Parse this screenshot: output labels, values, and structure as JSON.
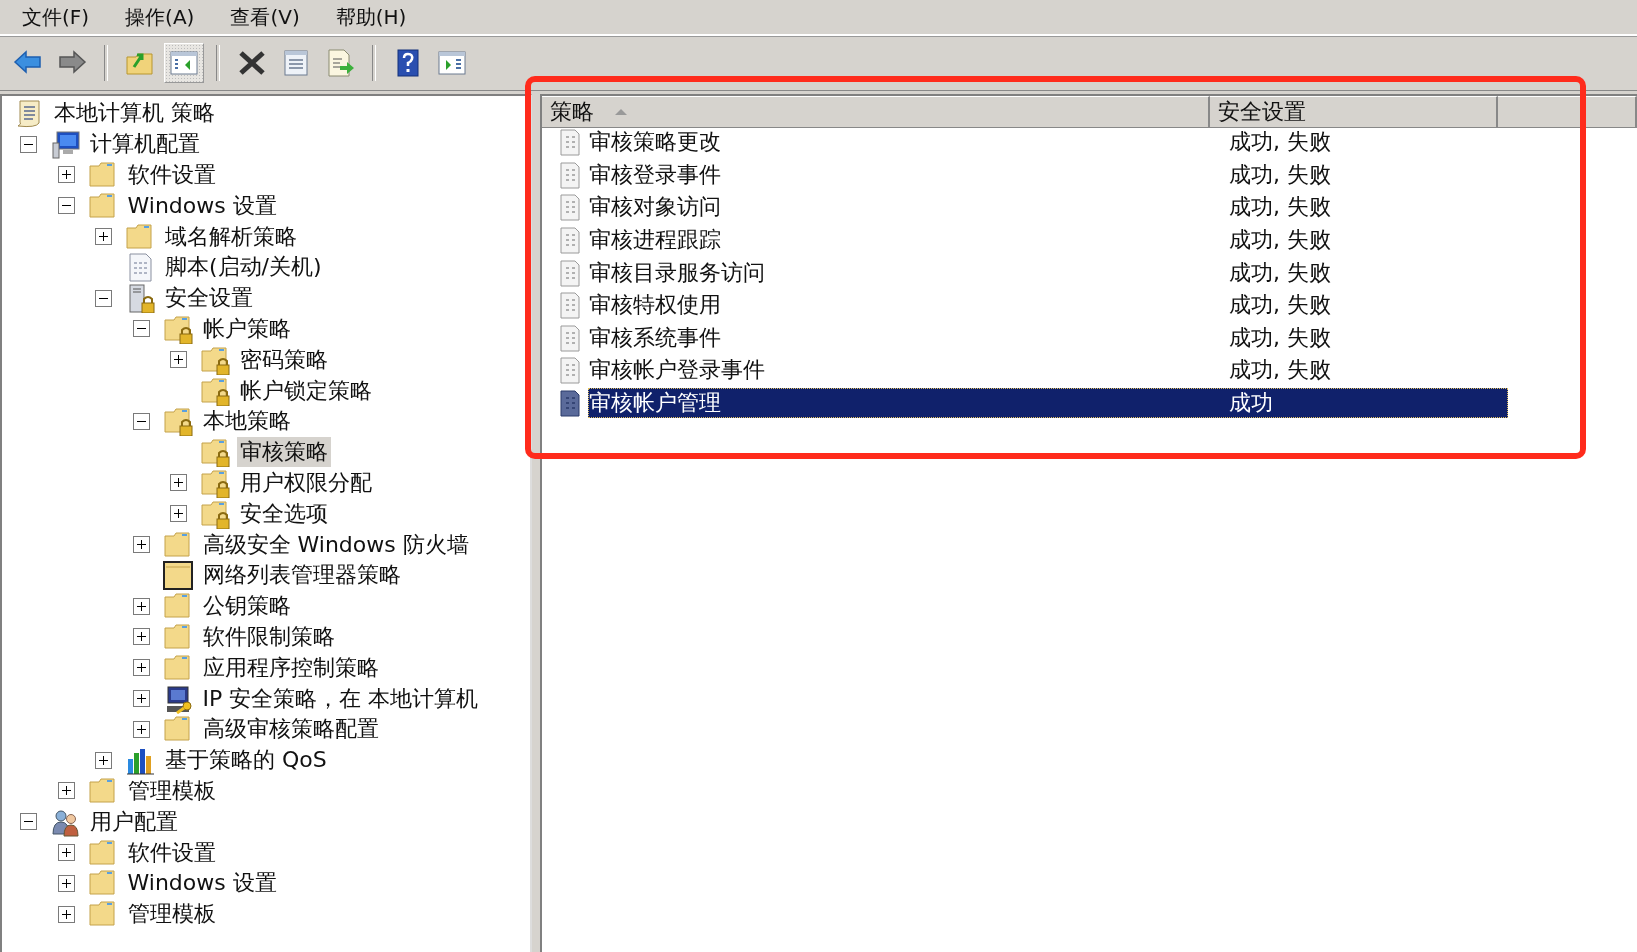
{
  "menu": [
    "文件(F)",
    "操作(A)",
    "查看(V)",
    "帮助(H)"
  ],
  "toolbar": [
    {
      "kind": "back"
    },
    {
      "kind": "forward"
    },
    {
      "kind": "sep"
    },
    {
      "kind": "up"
    },
    {
      "kind": "tree",
      "pressed": true
    },
    {
      "kind": "sep"
    },
    {
      "kind": "delete"
    },
    {
      "kind": "properties"
    },
    {
      "kind": "export"
    },
    {
      "kind": "sep"
    },
    {
      "kind": "help"
    },
    {
      "kind": "actionpane"
    }
  ],
  "tree": [
    {
      "label": "本地计算机 策略",
      "kind": "policy",
      "selected": false,
      "children": [
        {
          "label": "计算机配置",
          "kind": "computer",
          "expanded": true,
          "selected": false,
          "children": [
            {
              "label": "软件设置",
              "kind": "folder",
              "expanded": false,
              "selected": false
            },
            {
              "label": "Windows 设置",
              "kind": "folder",
              "expanded": true,
              "selected": false,
              "children": [
                {
                  "label": "域名解析策略",
                  "kind": "folder",
                  "expanded": false,
                  "selected": false
                },
                {
                  "label": "脚本(启动/关机)",
                  "kind": "script",
                  "selected": false
                },
                {
                  "label": "安全设置",
                  "kind": "security",
                  "expanded": true,
                  "selected": false,
                  "children": [
                    {
                      "label": "帐户策略",
                      "kind": "lockfolder",
                      "expanded": true,
                      "selected": false,
                      "children": [
                        {
                          "label": "密码策略",
                          "kind": "lockfolder",
                          "expanded": false,
                          "selected": false
                        },
                        {
                          "label": "帐户锁定策略",
                          "kind": "lockfolder",
                          "selected": false
                        }
                      ]
                    },
                    {
                      "label": "本地策略",
                      "kind": "lockfolder",
                      "expanded": true,
                      "selected": false,
                      "children": [
                        {
                          "label": "审核策略",
                          "kind": "lockfolder",
                          "selected": true
                        },
                        {
                          "label": "用户权限分配",
                          "kind": "lockfolder",
                          "expanded": false,
                          "selected": false
                        },
                        {
                          "label": "安全选项",
                          "kind": "lockfolder",
                          "expanded": false,
                          "selected": false
                        }
                      ]
                    },
                    {
                      "label": "高级安全 Windows 防火墙",
                      "kind": "folder",
                      "expanded": false,
                      "selected": false
                    },
                    {
                      "label": "网络列表管理器策略",
                      "kind": "framedfolder",
                      "selected": false
                    },
                    {
                      "label": "公钥策略",
                      "kind": "folder",
                      "expanded": false,
                      "selected": false
                    },
                    {
                      "label": "软件限制策略",
                      "kind": "folder",
                      "expanded": false,
                      "selected": false
                    },
                    {
                      "label": "应用程序控制策略",
                      "kind": "folder",
                      "expanded": false,
                      "selected": false
                    },
                    {
                      "label": "IP 安全策略，在 本地计算机",
                      "kind": "ipsec",
                      "expanded": false,
                      "selected": false
                    },
                    {
                      "label": "高级审核策略配置",
                      "kind": "folder",
                      "expanded": false,
                      "selected": false
                    }
                  ]
                },
                {
                  "label": "基于策略的 QoS",
                  "kind": "chart",
                  "expanded": false,
                  "selected": false
                }
              ]
            },
            {
              "label": "管理模板",
              "kind": "folder",
              "expanded": false,
              "selected": false
            }
          ]
        },
        {
          "label": "用户配置",
          "kind": "users",
          "expanded": true,
          "selected": false,
          "children": [
            {
              "label": "软件设置",
              "kind": "folder",
              "expanded": false,
              "selected": false
            },
            {
              "label": "Windows 设置",
              "kind": "folder",
              "expanded": false,
              "selected": false
            },
            {
              "label": "管理模板",
              "kind": "folder",
              "expanded": false,
              "selected": false
            }
          ]
        }
      ]
    }
  ],
  "table": {
    "columns": [
      {
        "label": "策略",
        "sorted_ascending": true
      },
      {
        "label": "安全设置"
      },
      {}
    ],
    "rows": [
      {
        "policy": "审核策略更改",
        "setting": "成功, 失败",
        "selected": false
      },
      {
        "policy": "审核登录事件",
        "setting": "成功, 失败",
        "selected": false
      },
      {
        "policy": "审核对象访问",
        "setting": "成功, 失败",
        "selected": false
      },
      {
        "policy": "审核进程跟踪",
        "setting": "成功, 失败",
        "selected": false
      },
      {
        "policy": "审核目录服务访问",
        "setting": "成功, 失败",
        "selected": false
      },
      {
        "policy": "审核特权使用",
        "setting": "成功, 失败",
        "selected": false
      },
      {
        "policy": "审核系统事件",
        "setting": "成功, 失败",
        "selected": false
      },
      {
        "policy": "审核帐户登录事件",
        "setting": "成功, 失败",
        "selected": false
      },
      {
        "policy": "审核帐户管理",
        "setting": "成功",
        "selected": true
      }
    ]
  }
}
